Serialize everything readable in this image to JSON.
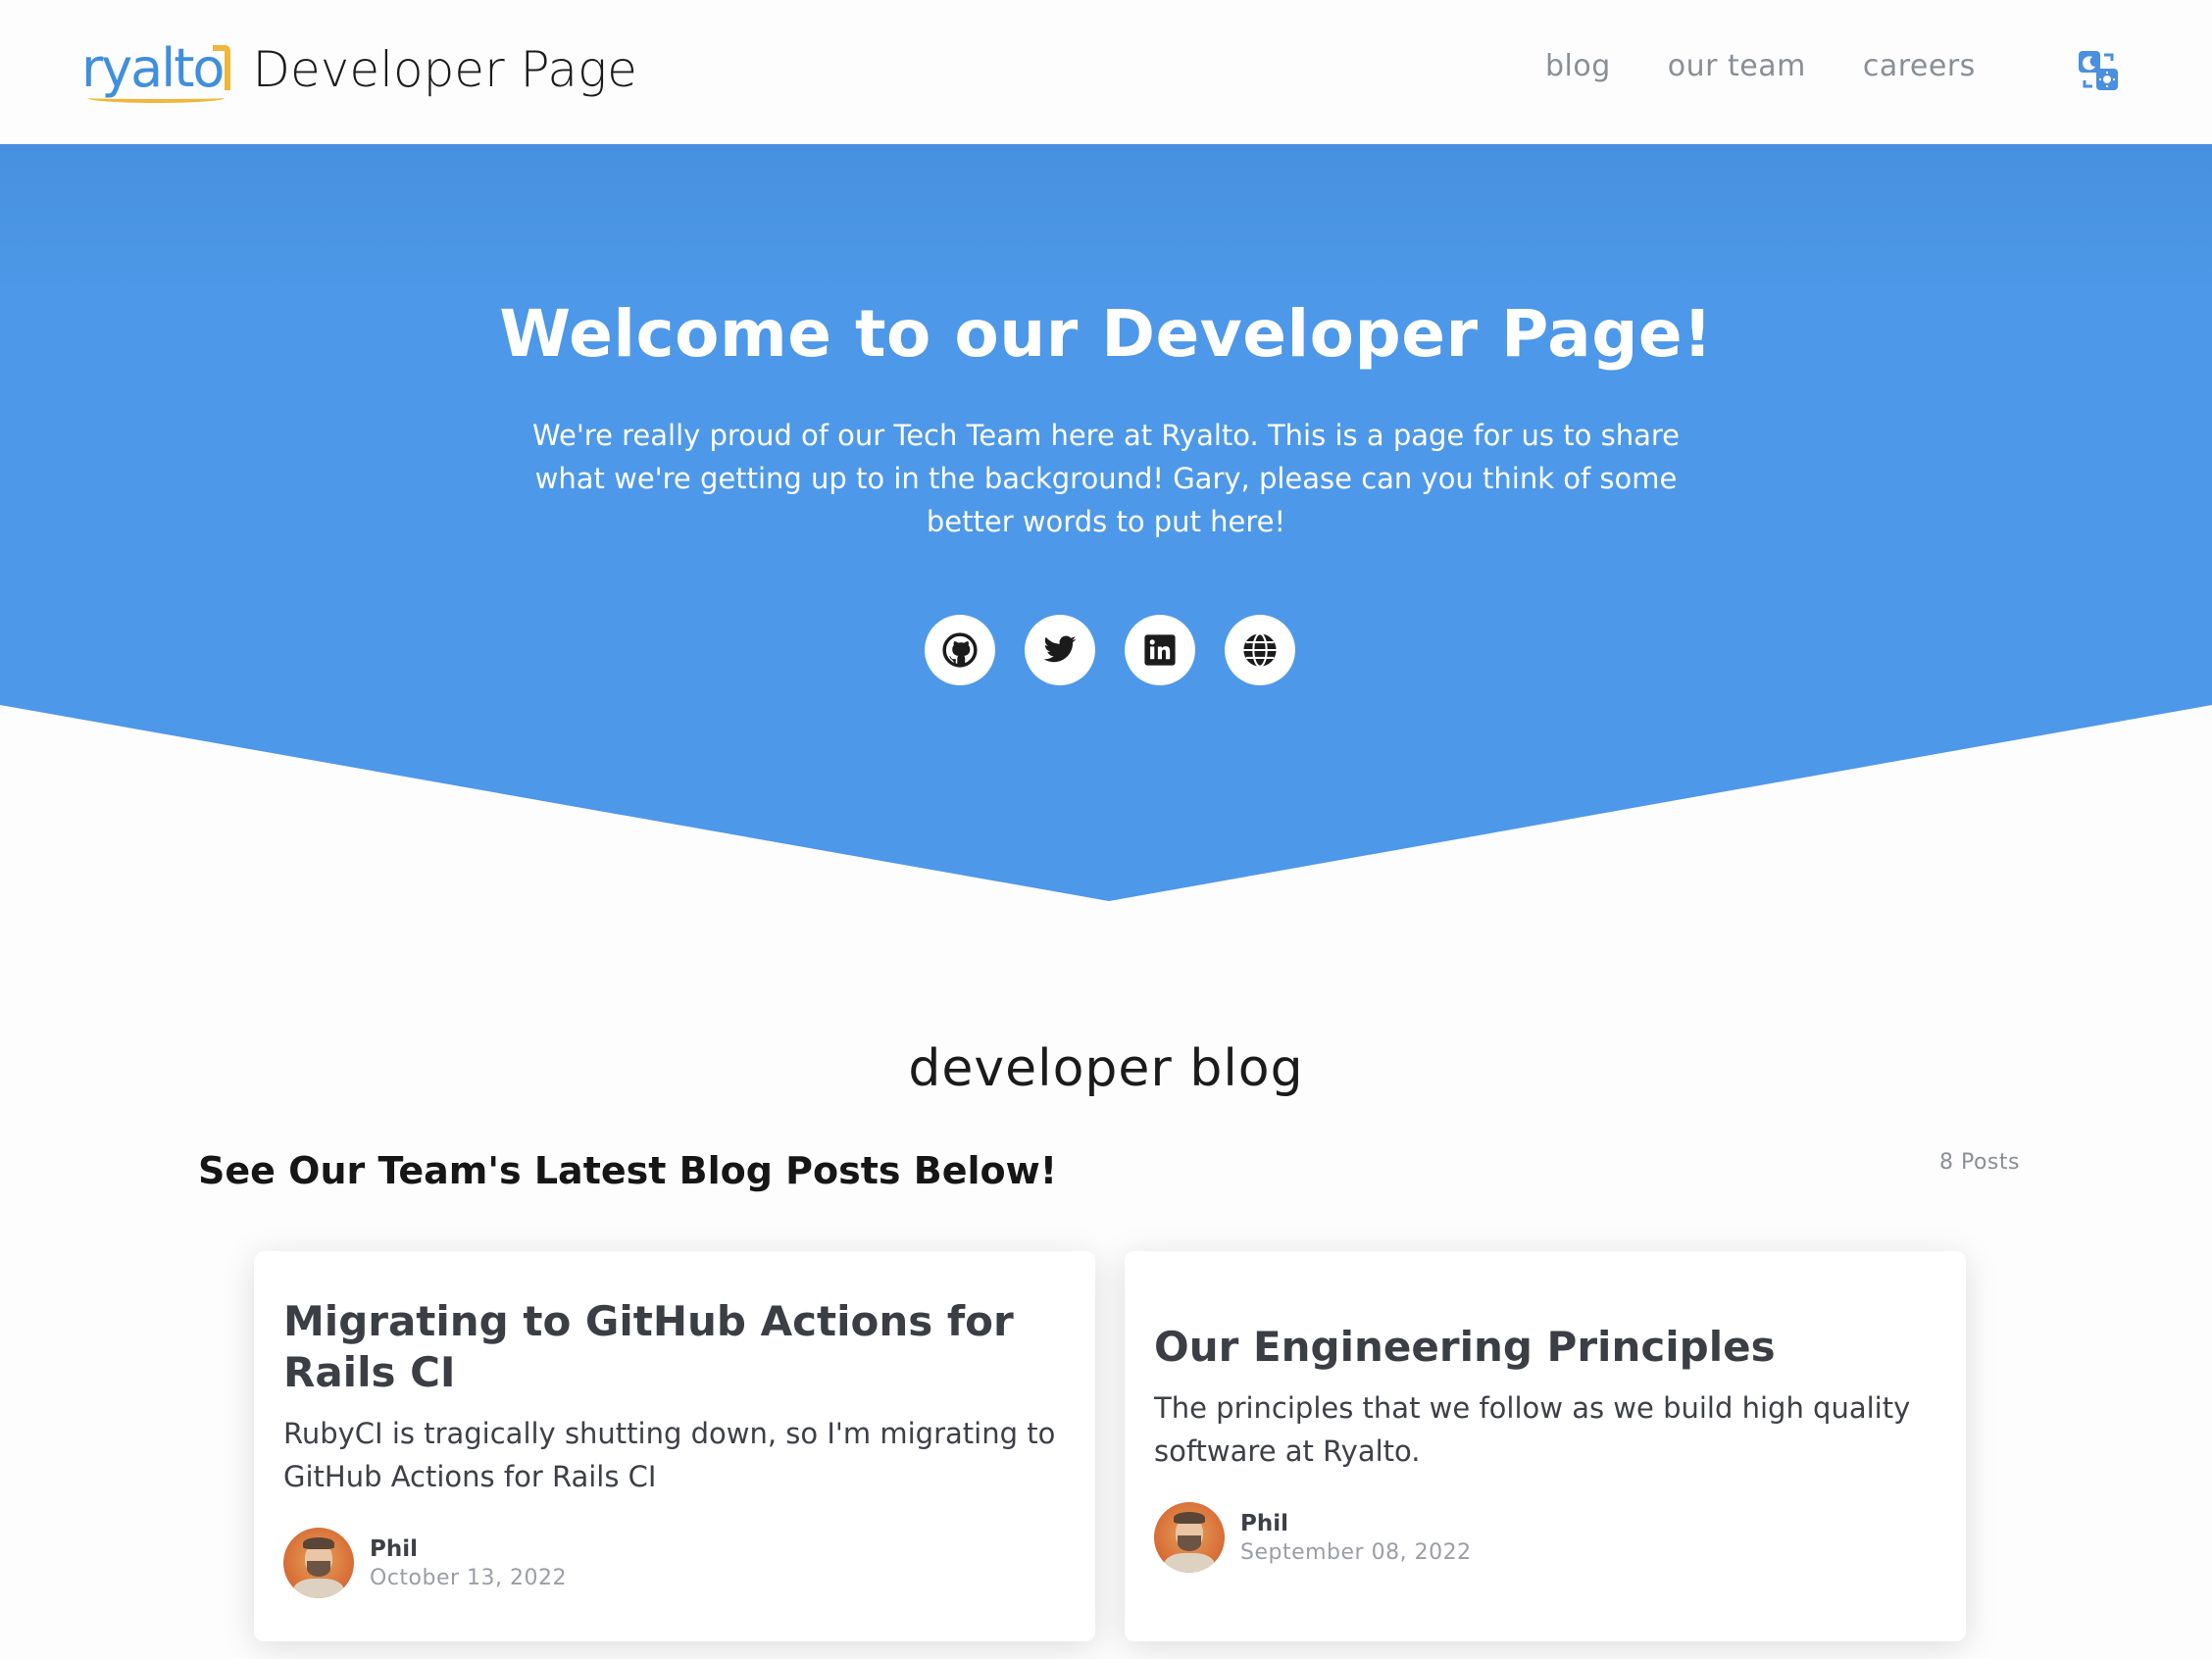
{
  "header": {
    "logo_text": "ryalto",
    "site_title": "Developer Page",
    "nav": [
      "blog",
      "our team",
      "careers"
    ],
    "theme_toggle_icon": "theme-toggle-icon"
  },
  "hero": {
    "title": "Welcome to our Developer Page!",
    "text": "We're really proud of our Tech Team here at Ryalto. This is a page for us to share what we're getting up to in the background! Gary, please can you think of some better words to put here!",
    "background_color": "#4d98e6",
    "socials": [
      "github-icon",
      "twitter-icon",
      "linkedin-icon",
      "globe-icon"
    ]
  },
  "blog": {
    "heading": "developer blog",
    "subheading": "See Our Team's Latest Blog Posts Below!",
    "post_count": "8 Posts",
    "posts": [
      {
        "title": "Migrating to GitHub Actions for Rails CI",
        "description": "RubyCI is tragically shutting down, so I'm migrating to GitHub Actions for Rails CI",
        "author": "Phil",
        "date": "October 13, 2022"
      },
      {
        "title": "Our Engineering Principles",
        "description": "The principles that we follow as we build high quality software at Ryalto.",
        "author": "Phil",
        "date": "September 08, 2022"
      }
    ]
  }
}
